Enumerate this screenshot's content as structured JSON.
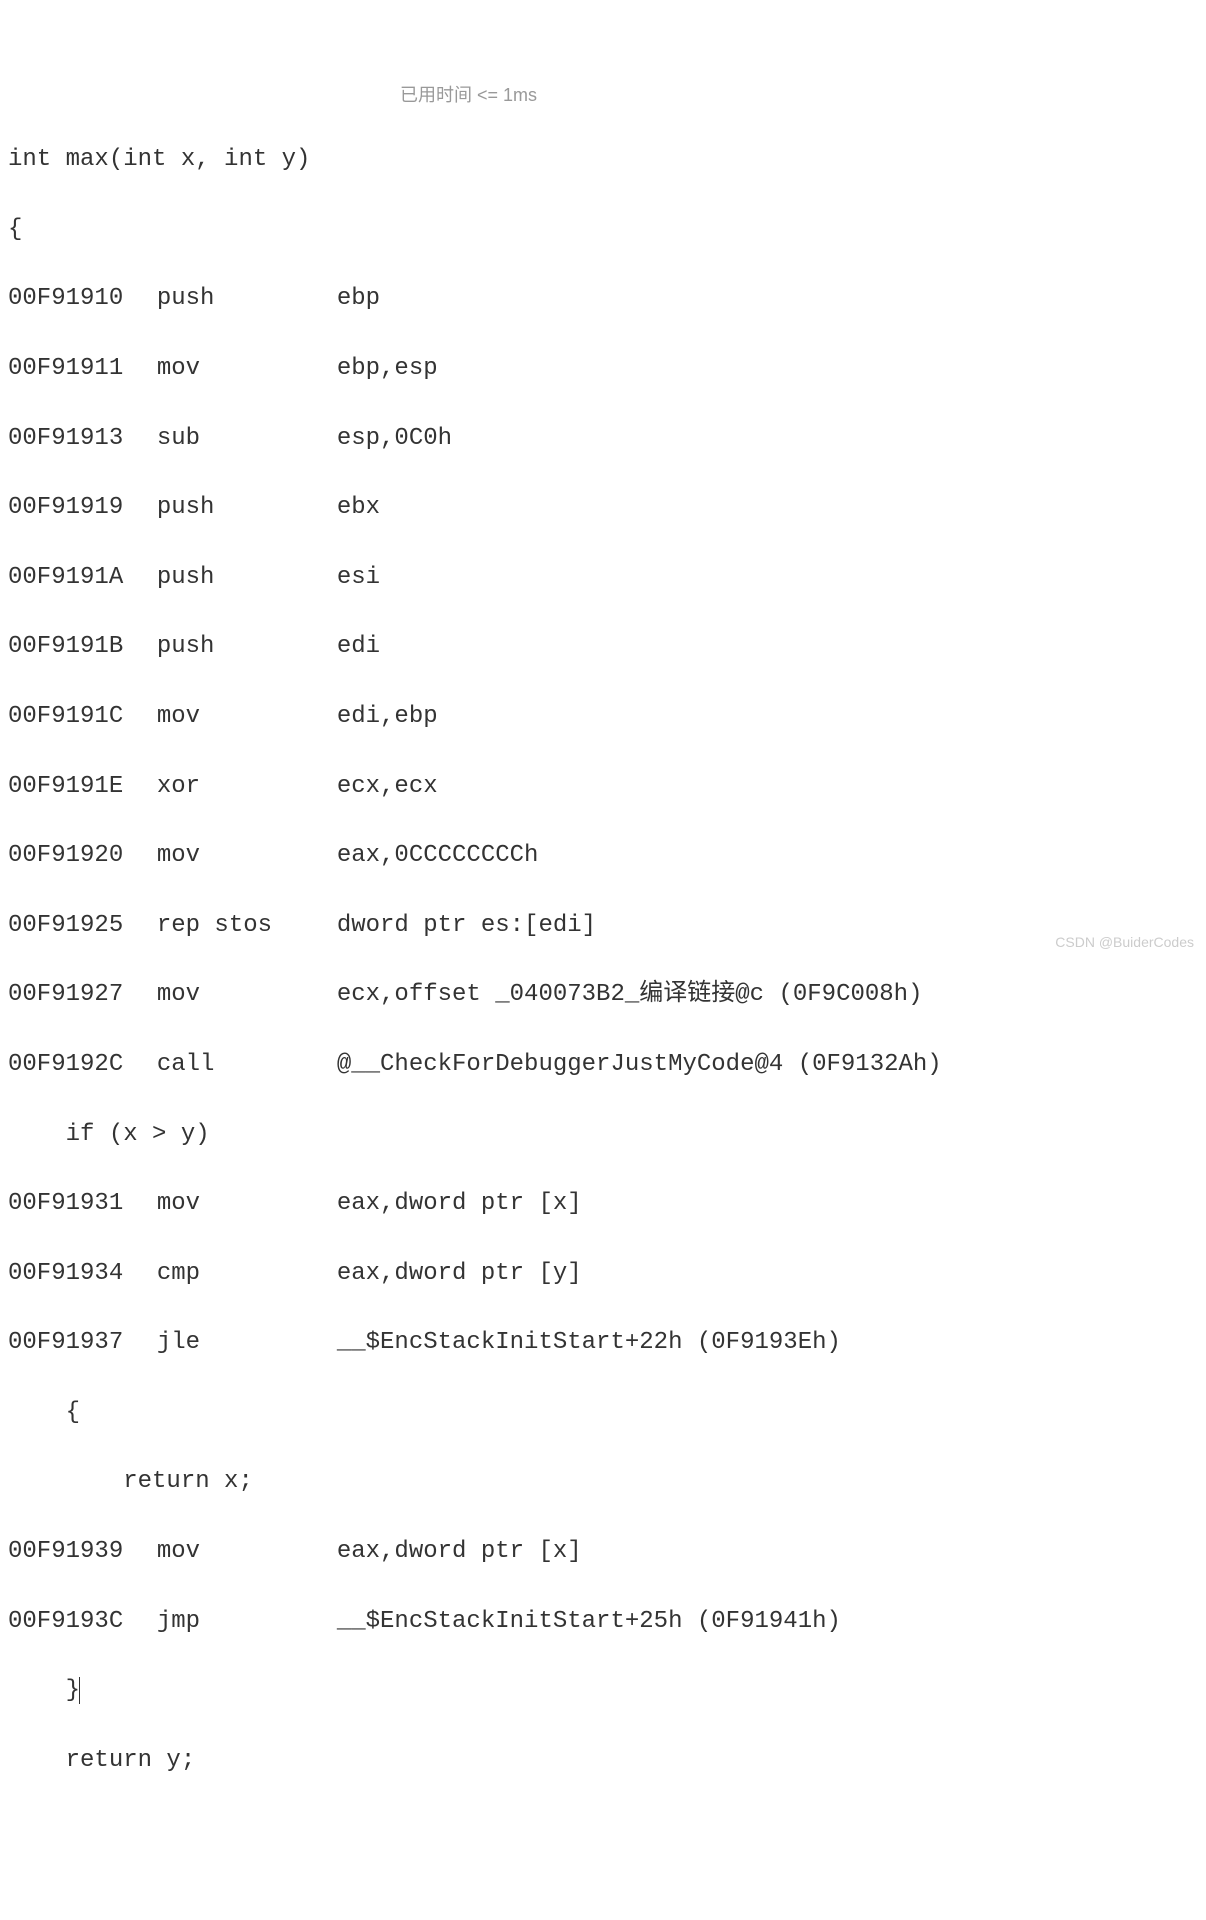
{
  "source": {
    "signature": "int max(int x, int y)",
    "open_brace": "{",
    "if_line": "    if (x > y)",
    "inner_open": "    {",
    "return_x": "        return x;",
    "inner_close": "    }",
    "return_y": "    return y;"
  },
  "asm": [
    {
      "addr": "00F91910",
      "instr": "push",
      "operand": "ebp  "
    },
    {
      "addr": "00F91911",
      "instr": "mov",
      "operand": "ebp,esp  "
    },
    {
      "addr": "00F91913",
      "instr": "sub",
      "operand": "esp,0C0h  "
    },
    {
      "addr": "00F91919",
      "instr": "push",
      "operand": "ebx  "
    },
    {
      "addr": "00F9191A",
      "instr": "push",
      "operand": "esi  "
    },
    {
      "addr": "00F9191B",
      "instr": "push",
      "operand": "edi  "
    },
    {
      "addr": "00F9191C",
      "instr": "mov",
      "operand": "edi,ebp  "
    },
    {
      "addr": "00F9191E",
      "instr": "xor",
      "operand": "ecx,ecx  "
    },
    {
      "addr": "00F91920",
      "instr": "mov",
      "operand": "eax,0CCCCCCCCh  "
    },
    {
      "addr": "00F91925",
      "instr": "rep stos",
      "operand": "dword ptr es:[edi]  "
    },
    {
      "addr": "00F91927",
      "instr": "mov",
      "operand": "ecx,offset _040073B2_编译链接@c (0F9C008h)  "
    },
    {
      "addr": "00F9192C",
      "instr": "call",
      "operand": "@__CheckForDebuggerJustMyCode@4 (0F9132Ah)  "
    },
    {
      "addr": "00F91931",
      "instr": "mov",
      "operand": "eax,dword ptr [x]  "
    },
    {
      "addr": "00F91934",
      "instr": "cmp",
      "operand": "eax,dword ptr [y]  "
    },
    {
      "addr": "00F91937",
      "instr": "jle",
      "operand": "__$EncStackInitStart+22h (0F9193Eh)  "
    },
    {
      "addr": "00F91939",
      "instr": "mov",
      "operand": "eax,dword ptr [x]  "
    },
    {
      "addr": "00F9193C",
      "instr": "jmp",
      "operand": "__$EncStackInitStart+25h (0F91941h)  "
    }
  ],
  "timing_hint": "已用时间 <= 1ms",
  "watermark": "CSDN @BuiderCodes"
}
